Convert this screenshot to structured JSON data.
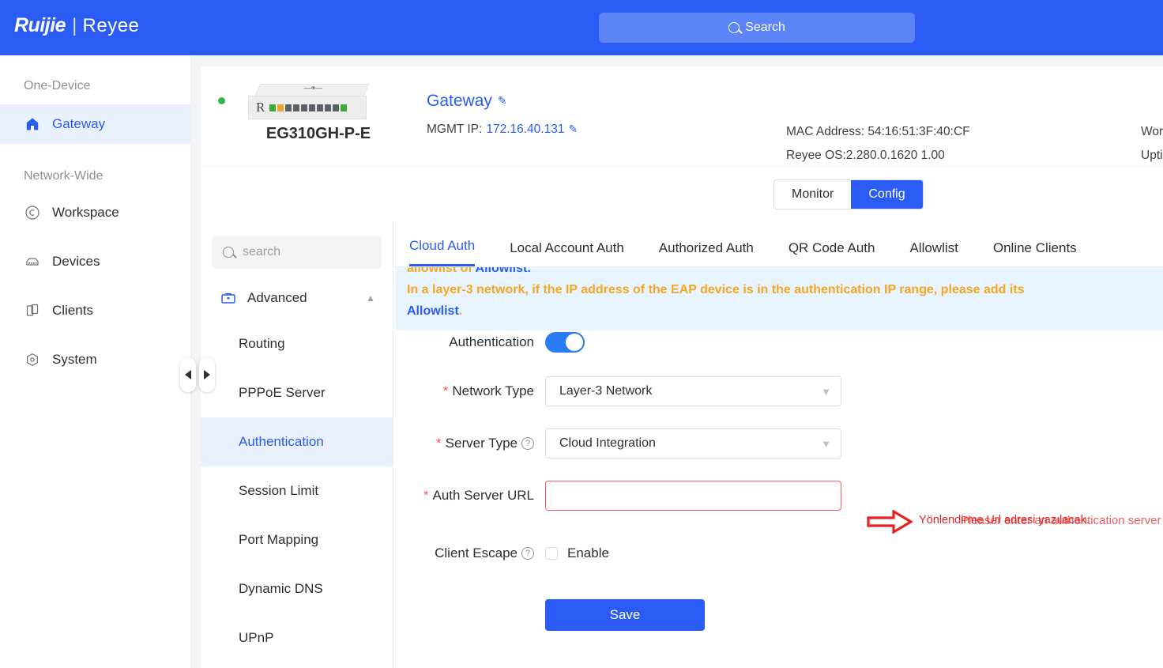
{
  "header": {
    "brand_primary": "Ruijie",
    "brand_separator": "|",
    "brand_secondary": "Reyee",
    "search_label": "Search",
    "search_icon": "search-icon",
    "bg_color": "#2a5cf5"
  },
  "sidebar": {
    "group_one_device": "One-Device",
    "group_network_wide": "Network-Wide",
    "items": [
      {
        "label": "Gateway",
        "icon": "home-icon",
        "active": true
      },
      {
        "label": "Workspace",
        "icon": "workspace-icon",
        "active": false
      },
      {
        "label": "Devices",
        "icon": "devices-icon",
        "active": false
      },
      {
        "label": "Clients",
        "icon": "clients-icon",
        "active": false
      },
      {
        "label": "System",
        "icon": "system-icon",
        "active": false
      }
    ],
    "collapse_left_icon": "chevron-left-icon",
    "collapse_right_icon": "chevron-right-icon"
  },
  "device": {
    "model": "EG310GH-P-E",
    "status": "online",
    "name": "Gateway",
    "name_edit_icon": "pencil-icon",
    "mgmt_ip_label": "MGMT IP:",
    "mgmt_ip_value": "172.16.40.131",
    "mgmt_ip_edit_icon": "pencil-icon",
    "mac_address": "MAC Address: 54:16:51:3F:40:CF",
    "reyee_os": "Reyee OS:2.280.0.1620 1.00",
    "working_mode_truncated": "Worki",
    "uptime_truncated": "Uptim",
    "router_label": "R"
  },
  "mode_switch": {
    "monitor": "Monitor",
    "config": "Config",
    "selected": "Config"
  },
  "subnav": {
    "search_placeholder": "search",
    "search_icon": "search-icon",
    "group": {
      "label": "Advanced",
      "icon": "briefcase-icon",
      "chevron": "chevron-up-icon"
    },
    "items": [
      {
        "label": "Routing",
        "active": false
      },
      {
        "label": "PPPoE Server",
        "active": false
      },
      {
        "label": "Authentication",
        "active": true
      },
      {
        "label": "Session Limit",
        "active": false
      },
      {
        "label": "Port Mapping",
        "active": false
      },
      {
        "label": "Dynamic DNS",
        "active": false
      },
      {
        "label": "UPnP",
        "active": false
      }
    ]
  },
  "tabs": [
    {
      "label": "Cloud Auth",
      "active": true
    },
    {
      "label": "Local Account Auth",
      "active": false
    },
    {
      "label": "Authorized Auth",
      "active": false
    },
    {
      "label": "QR Code Auth",
      "active": false
    },
    {
      "label": "Allowlist",
      "active": false
    },
    {
      "label": "Online Clients",
      "active": false
    }
  ],
  "notice": {
    "line1_text": "allowlist of ",
    "line1_link": "Allowlist.",
    "line2": "In a layer-3 network, if the IP address of the EAP device is in the authentication IP range, please add its",
    "line3_link": "Allowlist",
    "line3_tail": ".",
    "text_color": "#f5a623",
    "link_color": "#2a5cf5",
    "bg_color": "#e8f4fd"
  },
  "form": {
    "authentication": {
      "label": "Authentication",
      "enabled": true
    },
    "network_type": {
      "label": "Network Type",
      "required": true,
      "value": "Layer-3 Network"
    },
    "server_type": {
      "label": "Server Type",
      "required": true,
      "help_icon": "question-icon",
      "value": "Cloud Integration"
    },
    "auth_server_url": {
      "label": "Auth Server URL",
      "required": true,
      "value": "",
      "error": "Pleaser enter an authentication server URL."
    },
    "client_escape": {
      "label": "Client Escape",
      "help_icon": "question-icon",
      "checkbox_label": "Enable",
      "checked": false
    },
    "save_label": "Save"
  },
  "annotation": {
    "text": "Yönlendirme Url adresi yazılacak.",
    "arrow_icon": "arrow-right-icon",
    "color": "#e8201f"
  }
}
